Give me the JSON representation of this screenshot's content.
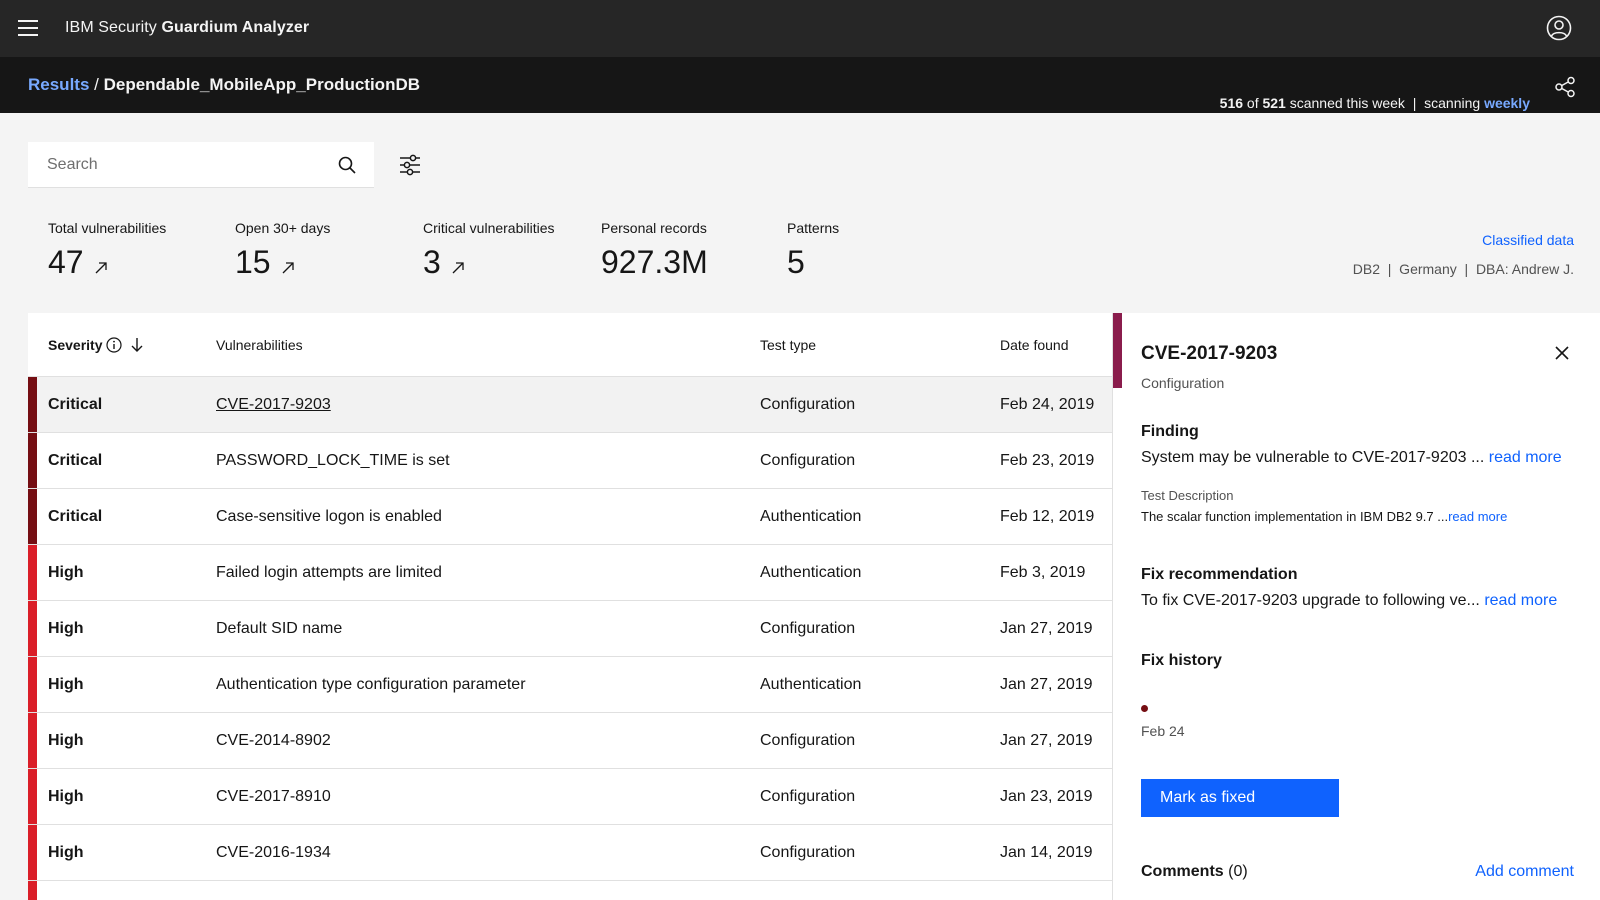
{
  "header": {
    "brand_prefix": "IBM Security ",
    "brand_bold": "Guardium Analyzer"
  },
  "subbar": {
    "crumb_link": "Results",
    "separator": " / ",
    "crumb_current": "Dependable_MobileApp_ProductionDB",
    "scanned_count": "516",
    "of_text": " of ",
    "total_count": "521",
    "scanned_suffix": " scanned this week",
    "divider": "  |  ",
    "scanning_text": "scanning ",
    "frequency": "weekly"
  },
  "search": {
    "placeholder": "Search"
  },
  "stats": [
    {
      "label": "Total vulnerabilities",
      "value": "47"
    },
    {
      "label": "Open 30+ days",
      "value": "15"
    },
    {
      "label": "Critical vulnerabilities",
      "value": "3"
    },
    {
      "label": "Personal records",
      "value": "927.3M"
    },
    {
      "label": "Patterns",
      "value": "5"
    }
  ],
  "classified": {
    "link": "Classified data",
    "meta": "DB2  |  Germany  |  DBA: Andrew J."
  },
  "table": {
    "columns": {
      "severity": "Severity",
      "vulnerabilities": "Vulnerabilities",
      "test_type": "Test type",
      "date_found": "Date found"
    },
    "rows": [
      {
        "severity": "Critical",
        "vulnerability": "CVE-2017-9203",
        "test_type": "Configuration",
        "date": "Feb 24, 2019"
      },
      {
        "severity": "Critical",
        "vulnerability": "PASSWORD_LOCK_TIME is set",
        "test_type": "Configuration",
        "date": "Feb 23, 2019"
      },
      {
        "severity": "Critical",
        "vulnerability": "Case-sensitive logon is enabled",
        "test_type": "Authentication",
        "date": "Feb 12, 2019"
      },
      {
        "severity": "High",
        "vulnerability": "Failed login attempts are limited",
        "test_type": "Authentication",
        "date": "Feb 3, 2019"
      },
      {
        "severity": "High",
        "vulnerability": "Default SID name",
        "test_type": "Configuration",
        "date": "Jan 27, 2019"
      },
      {
        "severity": "High",
        "vulnerability": "Authentication type configuration parameter",
        "test_type": "Authentication",
        "date": "Jan 27, 2019"
      },
      {
        "severity": "High",
        "vulnerability": "CVE-2014-8902",
        "test_type": "Configuration",
        "date": "Jan 27, 2019"
      },
      {
        "severity": "High",
        "vulnerability": "CVE-2017-8910",
        "test_type": "Configuration",
        "date": "Jan 23, 2019"
      },
      {
        "severity": "High",
        "vulnerability": "CVE-2016-1934",
        "test_type": "Configuration",
        "date": "Jan 14, 2019"
      },
      {
        "severity": "",
        "vulnerability": "",
        "test_type": "",
        "date": ""
      }
    ]
  },
  "colors": {
    "critical": "#750e13",
    "high": "#da1e28",
    "panel_accent": "#8a1c4c",
    "link": "#0f62fe"
  },
  "panel": {
    "title": "CVE-2017-9203",
    "subtitle": "Configuration",
    "finding_head": "Finding",
    "finding_text": "System may be vulnerable to CVE-2017-9203 ... ",
    "test_desc_label": "Test Description",
    "test_desc_text": "The scalar function implementation in IBM DB2 9.7 ...",
    "fix_head": "Fix recommendation",
    "fix_text": "To fix CVE-2017-9203 upgrade to following ve... ",
    "read_more": "read more",
    "history_head": "Fix history",
    "history_date": "Feb 24",
    "mark_button": "Mark as fixed",
    "comments_label": "Comments",
    "comments_count": " (0)",
    "add_comment": "Add comment"
  }
}
